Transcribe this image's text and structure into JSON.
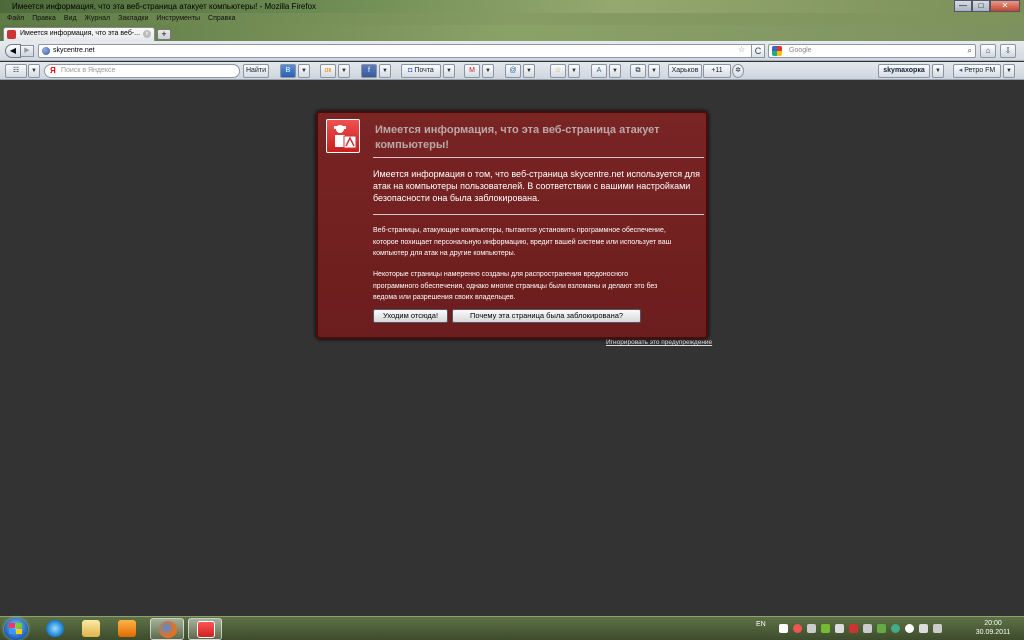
{
  "window": {
    "title": "Имеется информация, что эта веб-страница атакует компьютеры! - Mozilla Firefox",
    "minimize": "—",
    "maximize": "□",
    "close": "✕"
  },
  "menu": [
    "Файл",
    "Правка",
    "Вид",
    "Журнал",
    "Закладки",
    "Инструменты",
    "Справка"
  ],
  "tab": {
    "label": "Имеется информация, что эта веб-...",
    "close": "x",
    "new_tab": "+"
  },
  "nav": {
    "back": "◀",
    "forward": "▶",
    "url": "skycentre.net",
    "reload": "C",
    "search_placeholder": "Google"
  },
  "yandex_bar": {
    "search_placeholder": "Поиск в Яндексе",
    "search_button": "Найти",
    "ya_logo": "Я",
    "mail_label": "Почта",
    "weather_city": "Харьков",
    "weather_temp": "+11",
    "skymahorka": "skymaхорка",
    "radio": "Ретро FM"
  },
  "warning": {
    "title": "Имеется информация, что эта веб-страница атакует компьютеры!",
    "main_text": "Имеется информация о том, что веб-страница skycentre.net используется для атак на компьютеры пользователей. В соответствии с вашими настройками безопасности она была заблокирована.",
    "para1": "Веб-страницы, атакующие компьютеры, пытаются установить программное обеспечение, которое похищает персональную информацию, вредит вашей системе или использует ваш компьютер для атак на другие компьютеры.",
    "para2": "Некоторые страницы намеренно созданы для распространения вредоносного программного обеспечения, однако многие страницы были взломаны и делают это без ведома или разрешения своих владельцев.",
    "get_away_button": "Уходим отсюда!",
    "why_button": "Почему эта страница была заблокирована?",
    "ignore_link": "Игнорировать это предупреждение"
  },
  "taskbar": {
    "language": "EN",
    "time": "20:00",
    "date": "30.09.2011"
  },
  "colors": {
    "warning_bg": "#722222",
    "page_bg": "#333333",
    "taskbar": "#4a5a36"
  }
}
